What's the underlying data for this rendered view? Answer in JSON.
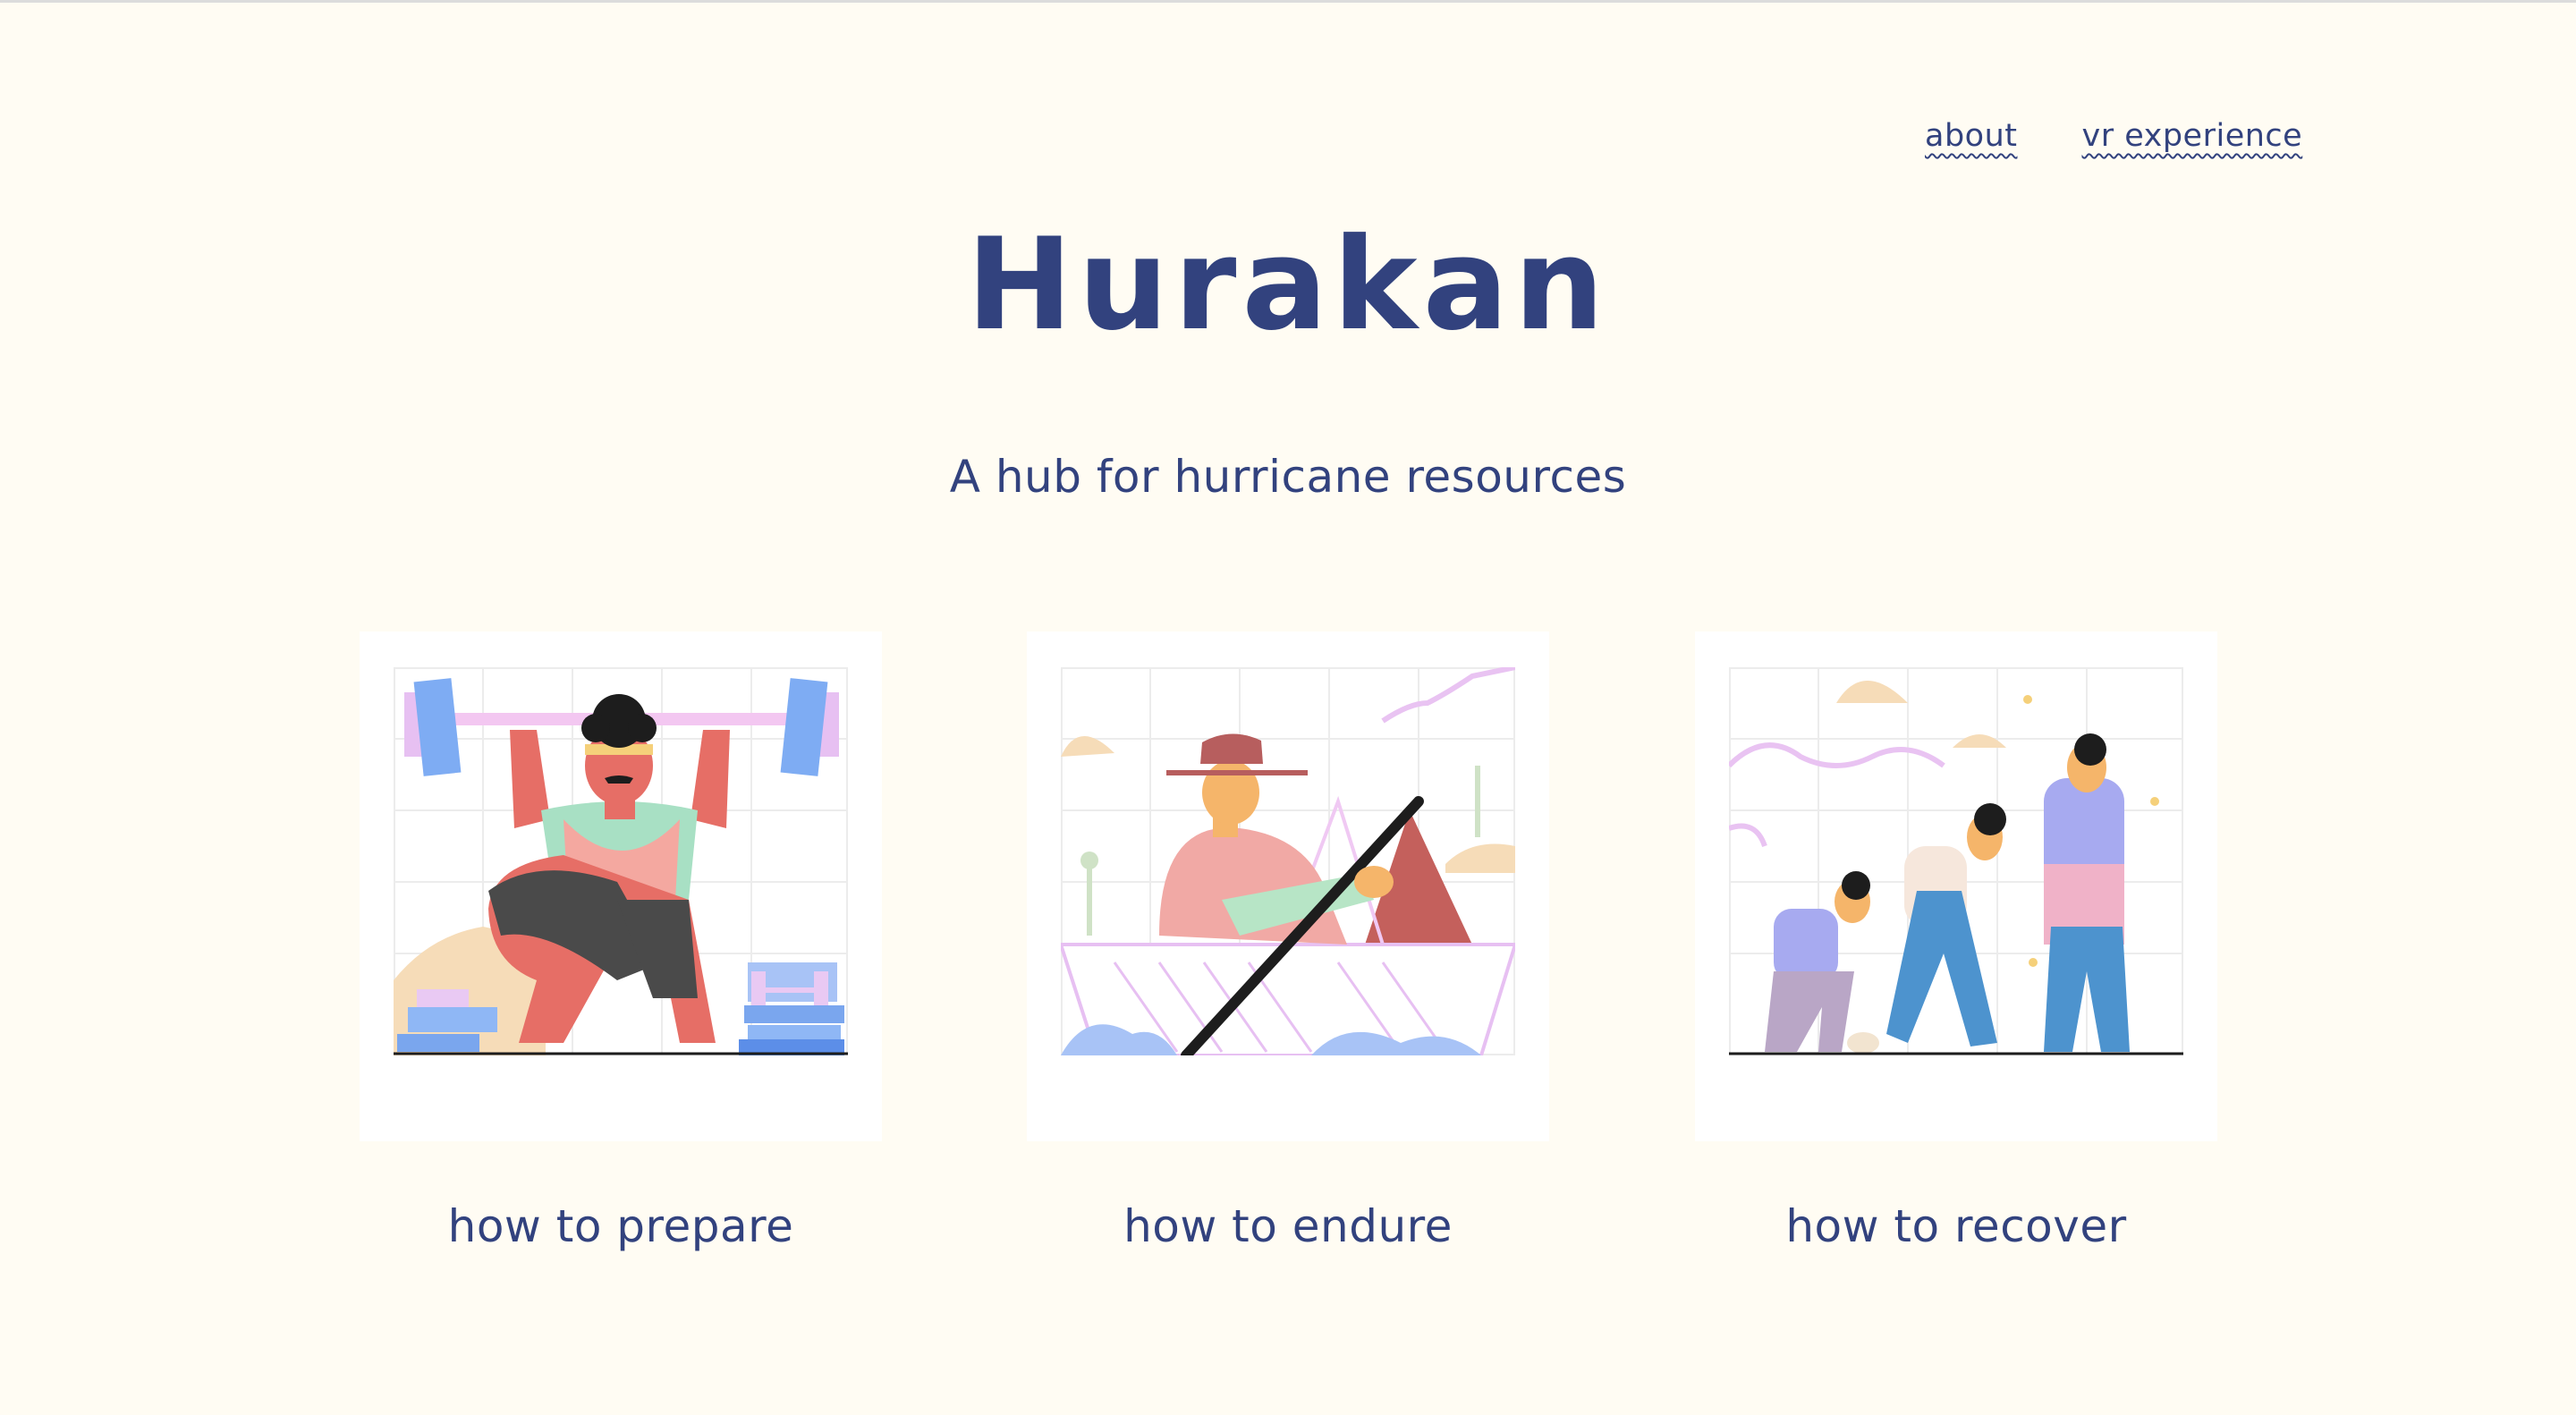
{
  "nav": {
    "about": "about",
    "vr_experience": "vr experience"
  },
  "title": "Hurakan",
  "subtitle": "A hub for hurricane resources",
  "cards": [
    {
      "label": "how to prepare",
      "icon": "weightlifter-illustration"
    },
    {
      "label": "how to endure",
      "icon": "rowing-boat-illustration"
    },
    {
      "label": "how to recover",
      "icon": "person-getting-up-illustration"
    }
  ],
  "colors": {
    "background": "#fffcf3",
    "text": "#32427e",
    "card": "#ffffff"
  }
}
